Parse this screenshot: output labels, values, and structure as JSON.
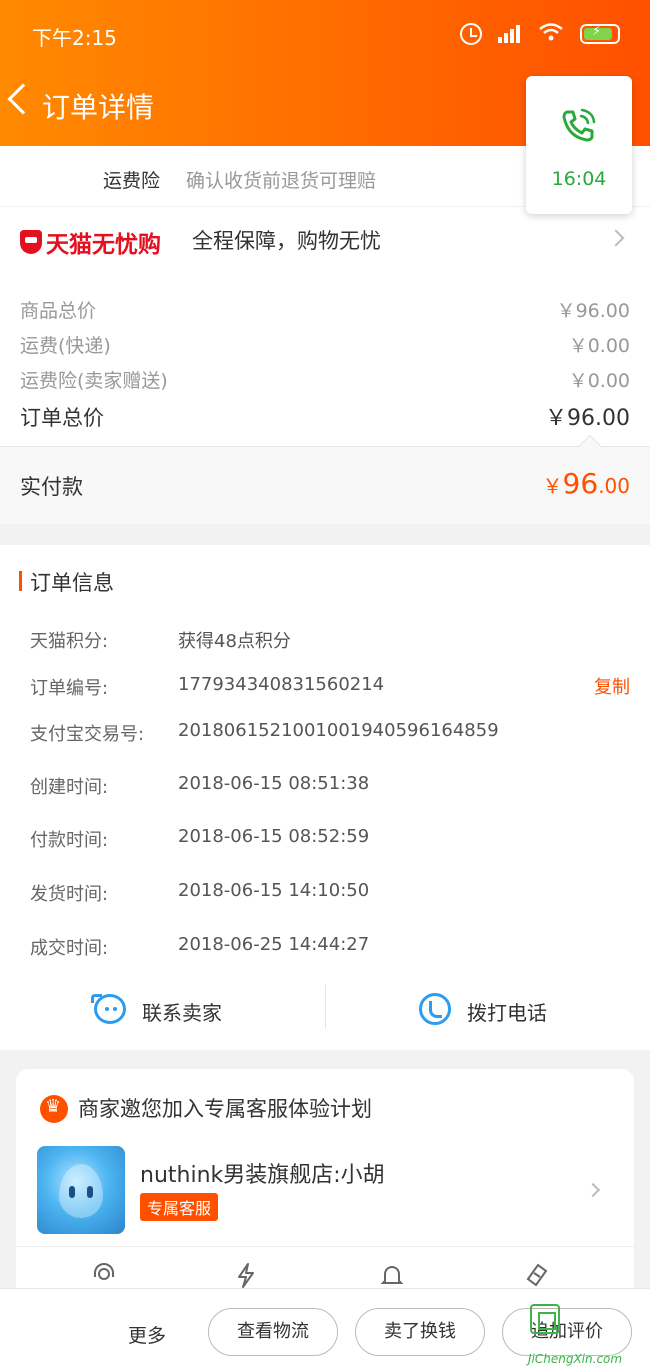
{
  "status_bar": {
    "time": "下午2:15"
  },
  "header": {
    "title": "订单详情"
  },
  "call_float": {
    "duration": "16:04"
  },
  "insurance": {
    "label": "运费险",
    "desc": "确认收货前退货可理赔"
  },
  "tmall": {
    "brand": "天猫无忧购",
    "slogan": "全程保障，购物无忧"
  },
  "price": {
    "rows": [
      {
        "label": "商品总价",
        "value": "￥96.00"
      },
      {
        "label": "运费(快递)",
        "value": "￥0.00"
      },
      {
        "label": "运费险(卖家赠送)",
        "value": "￥0.00"
      }
    ],
    "total_label": "订单总价",
    "total_value": "￥96.00"
  },
  "paid": {
    "label": "实付款",
    "currency": "￥",
    "integer": "96",
    "decimal": ".00"
  },
  "order_info": {
    "title": "订单信息",
    "rows": [
      {
        "label": "天猫积分:",
        "value": "获得48点积分"
      },
      {
        "label": "订单编号:",
        "value": "177934340831560214"
      },
      {
        "label": "支付宝交易号:",
        "value": "2018061521001001940596164859"
      },
      {
        "label": "创建时间:",
        "value": "2018-06-15 08:51:38"
      },
      {
        "label": "付款时间:",
        "value": "2018-06-15 08:52:59"
      },
      {
        "label": "发货时间:",
        "value": "2018-06-15 14:10:50"
      },
      {
        "label": "成交时间:",
        "value": "2018-06-25 14:44:27"
      }
    ],
    "copy_label": "复制"
  },
  "contact": {
    "seller_label": "联系卖家",
    "phone_label": "拨打电话"
  },
  "service": {
    "title": "商家邀您加入专属客服体验计划",
    "shop_name": "nuthink男装旗舰店:小胡",
    "badge": "专属客服"
  },
  "bottom_bar": {
    "more": "更多",
    "buttons": [
      "查看物流",
      "卖了换钱",
      "追加评价"
    ]
  },
  "watermark": {
    "text": "JiChengXin.com"
  },
  "colors": {
    "accent": "#ff5000",
    "link_blue": "#2b9cf2",
    "call_green": "#2aaa3a",
    "tmall_red": "#e5101f"
  }
}
